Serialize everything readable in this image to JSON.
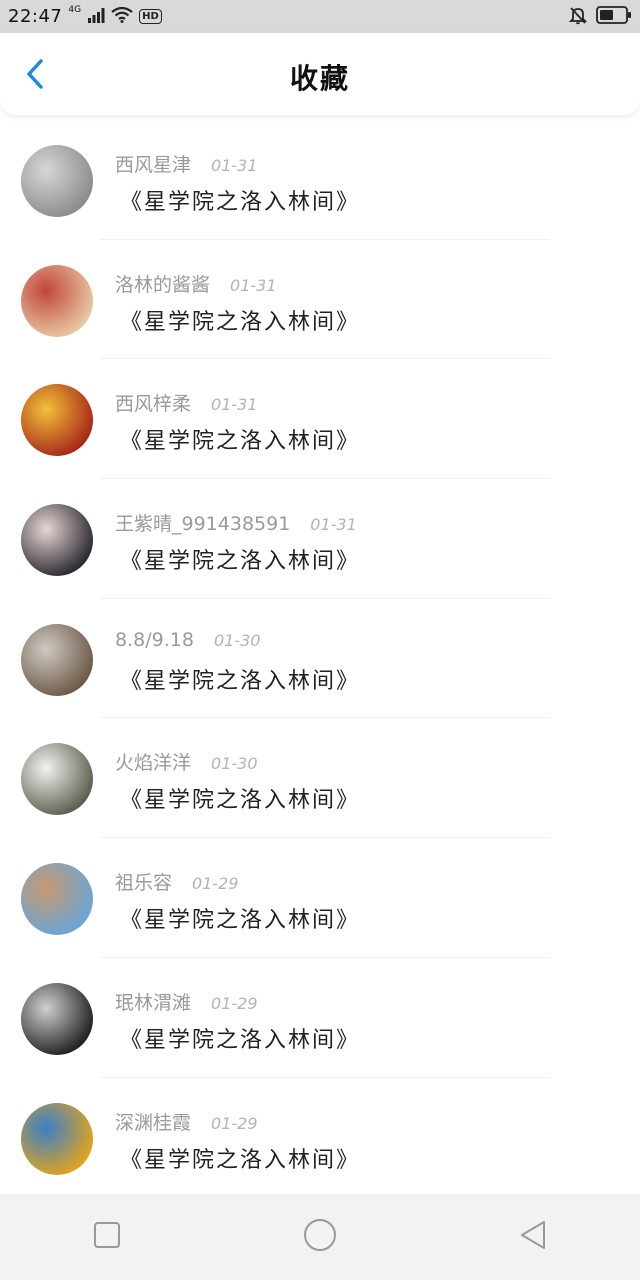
{
  "status_bar": {
    "time": "22:47",
    "network": "4G",
    "hd": "HD"
  },
  "header": {
    "title": "收藏"
  },
  "favorites": [
    {
      "username": "西风星津",
      "date": "01-31",
      "title": "《星学院之洛入林间》",
      "avatar_colors": [
        "#8c8c8c",
        "#d7d7d7"
      ]
    },
    {
      "username": "洛林的酱酱",
      "date": "01-31",
      "title": "《星学院之洛入林间》",
      "avatar_colors": [
        "#e8c7a3",
        "#c0463a"
      ]
    },
    {
      "username": "西风梓柔",
      "date": "01-31",
      "title": "《星学院之洛入林间》",
      "avatar_colors": [
        "#a82818",
        "#f3c13a"
      ]
    },
    {
      "username": "王紫晴_991438591",
      "date": "01-31",
      "title": "《星学院之洛入林间》",
      "avatar_colors": [
        "#2d2a32",
        "#e6d6d2"
      ]
    },
    {
      "username": "8.8/9.18",
      "date": "01-30",
      "title": "《星学院之洛入林间》",
      "avatar_colors": [
        "#6e5a48",
        "#cfcac3"
      ]
    },
    {
      "username": "火焰洋洋",
      "date": "01-30",
      "title": "《星学院之洛入林间》",
      "avatar_colors": [
        "#5d604f",
        "#f2f2f2"
      ]
    },
    {
      "username": "祖乐容",
      "date": "01-29",
      "title": "《星学院之洛入林间》",
      "avatar_colors": [
        "#6aa5d8",
        "#c69a6e"
      ]
    },
    {
      "username": "珉林渭滩",
      "date": "01-29",
      "title": "《星学院之洛入林间》",
      "avatar_colors": [
        "#222222",
        "#d0d0d0"
      ]
    },
    {
      "username": "深渊桂霞",
      "date": "01-29",
      "title": "《星学院之洛入林间》",
      "avatar_colors": [
        "#e0a31f",
        "#3b7fc9"
      ]
    }
  ],
  "colors": {
    "accent": "#1e88e5",
    "status_bg": "#d9d9d9",
    "nav_bg": "#f2f2f2"
  }
}
